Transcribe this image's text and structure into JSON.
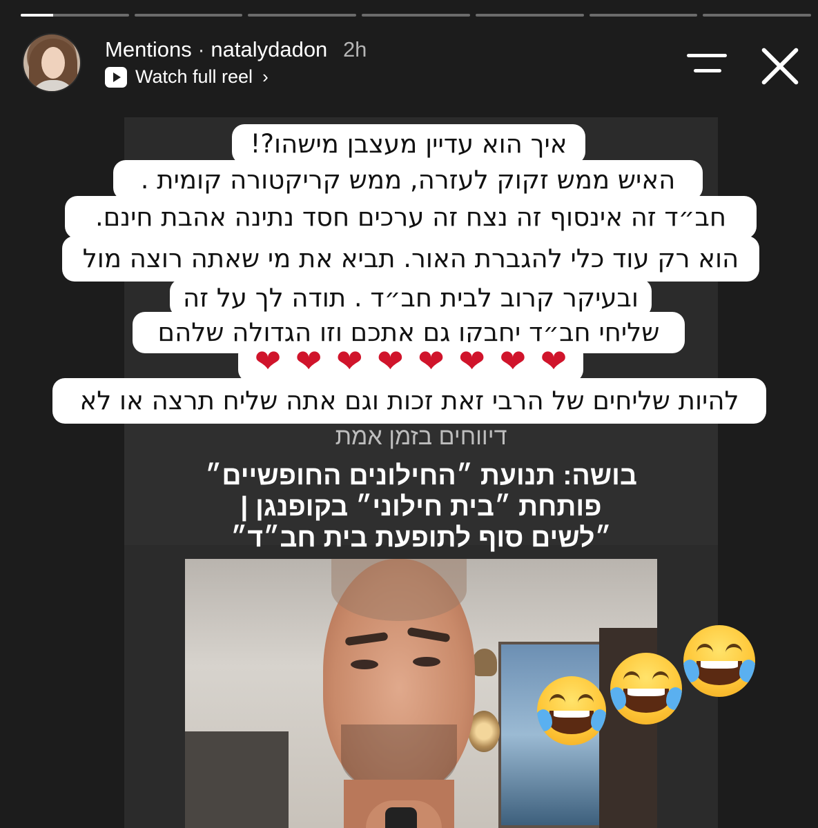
{
  "progress": {
    "segments": [
      0.3,
      0,
      0,
      0,
      0,
      0,
      0
    ]
  },
  "header": {
    "context": "Mentions",
    "separator": "·",
    "username": "natalydadon",
    "time": "2h",
    "watch_label": "Watch full reel",
    "chevron": "›"
  },
  "icons": {
    "avatar": "profile-photo",
    "play": "reel-play-icon",
    "menu": "menu-lines-icon",
    "close": "close-x-icon",
    "heart": "red-heart-emoji",
    "laugh": "tears-of-joy-emoji"
  },
  "sticker_lines": [
    "איך הוא עדיין מעצבן מישהו?!",
    "האיש ממש זקוק לעזרה,  ממש קריקטורה קומית .",
    "חב״ד זה אינסוף זה נצח זה ערכים חסד נתינה אהבת חינם.",
    "הוא רק עוד כלי להגברת האור. תביא את מי שאתה רוצה מול",
    "ובעיקר קרוב לבית חב״ד . תודה לך על זה",
    "שליחי חב״ד יחבקו גם אתכם וזו הגדולה שלהם",
    "להיות שליחים של הרבי זאת זכות וגם אתה שליח תרצה או לא"
  ],
  "hearts": [
    "❤",
    "❤",
    "❤",
    "❤",
    "❤",
    "❤",
    "❤",
    "❤"
  ],
  "reel": {
    "subcaption": "דיווחים בזמן אמת",
    "headline": [
      "בושה: תנועת ״החילונים החופשיים״",
      "פותחת ״בית חילוני״ בקופנגן |",
      "״לשים סוף לתופעת בית חב״ד״"
    ]
  },
  "colors": {
    "background": "#1c1c1c",
    "heart": "#d0142b",
    "sticker_bg": "#ffffff"
  }
}
